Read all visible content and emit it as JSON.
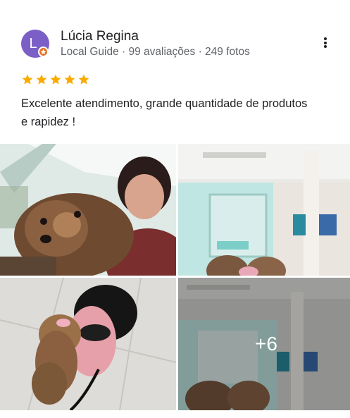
{
  "reviewer": {
    "avatar_letter": "L",
    "name": "Lúcia Regina",
    "meta": "Local Guide · 99 avaliações · 249 fotos"
  },
  "rating": {
    "stars": 5,
    "max": 5,
    "color": "#f9ab00"
  },
  "review": {
    "text": "Excelente atendimento, grande quantidade de produtos e rapidez !"
  },
  "photos": {
    "more_count": "+6"
  },
  "icons": {
    "menu": "more-vert-icon",
    "star": "star-icon",
    "badge": "local-guide-badge-icon"
  },
  "colors": {
    "avatar": "#7b5fc6",
    "badge": "#e8711c",
    "meta_text": "#5f6368"
  }
}
